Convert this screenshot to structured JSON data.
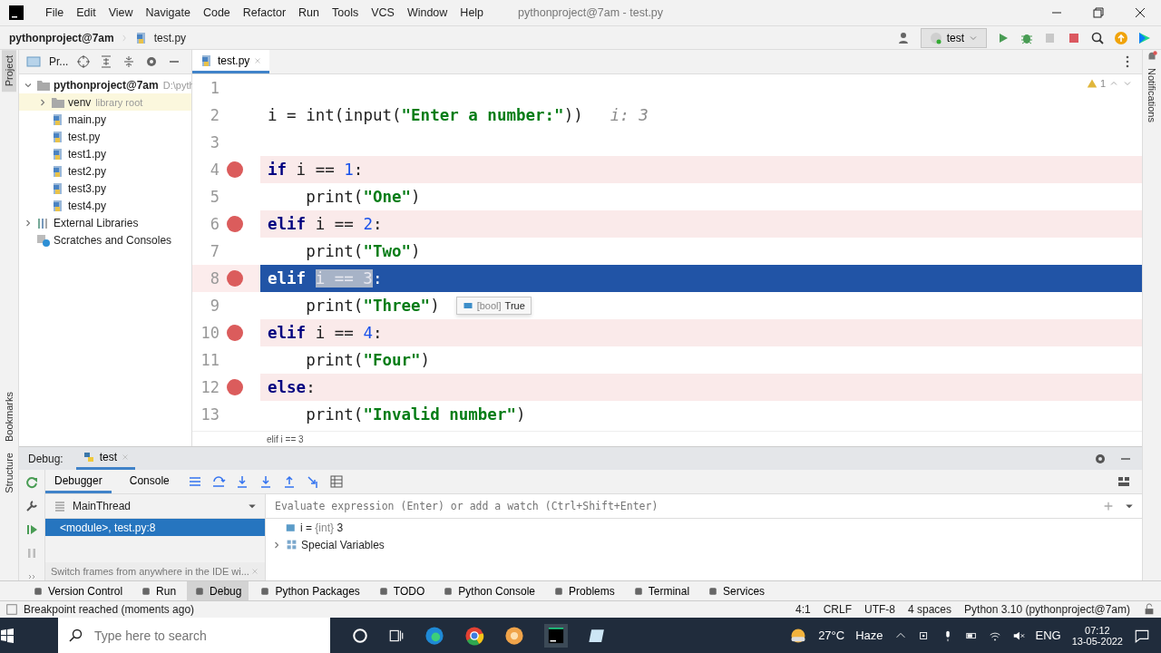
{
  "title_bar": {
    "menu": [
      "File",
      "Edit",
      "View",
      "Navigate",
      "Code",
      "Refactor",
      "Run",
      "Tools",
      "VCS",
      "Window",
      "Help"
    ],
    "title": "pythonproject@7am - test.py"
  },
  "nav_bar": {
    "breadcrumbs": [
      "pythonproject@7am",
      "test.py"
    ],
    "run_config": "test"
  },
  "side_strips": {
    "left_top": [
      {
        "label": "Project",
        "selected": true
      }
    ],
    "left_bottom": [
      {
        "label": "Bookmarks",
        "selected": false
      },
      {
        "label": "Structure",
        "selected": false
      }
    ],
    "right": [
      {
        "label": "Notifications",
        "selected": false
      }
    ]
  },
  "project_panel": {
    "title": "Pr...",
    "tree": [
      {
        "label": "pythonproject@7am",
        "hint": "D:\\pyth",
        "kind": "root",
        "expanded": true,
        "children": [
          {
            "label": "venv",
            "hint": "library root",
            "kind": "venv",
            "expanded": false
          },
          {
            "label": "main.py",
            "kind": "file"
          },
          {
            "label": "test.py",
            "kind": "file"
          },
          {
            "label": "test1.py",
            "kind": "file"
          },
          {
            "label": "test2.py",
            "kind": "file"
          },
          {
            "label": "test3.py",
            "kind": "file"
          },
          {
            "label": "test4.py",
            "kind": "file"
          }
        ]
      },
      {
        "label": "External Libraries",
        "kind": "library",
        "expanded": false
      },
      {
        "label": "Scratches and Consoles",
        "kind": "scratches"
      }
    ]
  },
  "editor": {
    "tabs": [
      {
        "label": "test.py",
        "selected": true
      }
    ],
    "inspection_count": "1",
    "breadcrumb": "elif i == 3",
    "lines": [
      {
        "number": "1",
        "breakpoint": false,
        "current": false
      },
      {
        "number": "2",
        "breakpoint": false,
        "current": false,
        "tokens": [
          {
            "kind": "plain",
            "text": "i = "
          },
          {
            "kind": "builtin",
            "text": "int"
          },
          {
            "kind": "plain",
            "text": "("
          },
          {
            "kind": "builtin",
            "text": "input"
          },
          {
            "kind": "plain",
            "text": "("
          },
          {
            "kind": "string",
            "text": "\"Enter a number:\""
          },
          {
            "kind": "plain",
            "text": "))"
          },
          {
            "kind": "hint",
            "text": "i: 3"
          }
        ]
      },
      {
        "number": "3",
        "breakpoint": false,
        "current": false
      },
      {
        "number": "4",
        "breakpoint": true,
        "current": false,
        "tokens": [
          {
            "kind": "keyword",
            "text": "if"
          },
          {
            "kind": "plain",
            "text": " i == "
          },
          {
            "kind": "number",
            "text": "1"
          },
          {
            "kind": "plain",
            "text": ":"
          }
        ]
      },
      {
        "number": "5",
        "breakpoint": false,
        "current": false,
        "indented": true,
        "tokens": [
          {
            "kind": "builtin",
            "text": "print"
          },
          {
            "kind": "plain",
            "text": "("
          },
          {
            "kind": "string",
            "text": "\"One\""
          },
          {
            "kind": "plain",
            "text": ")"
          }
        ]
      },
      {
        "number": "6",
        "breakpoint": true,
        "current": false,
        "tokens": [
          {
            "kind": "keyword",
            "text": "elif"
          },
          {
            "kind": "plain",
            "text": " i == "
          },
          {
            "kind": "number",
            "text": "2"
          },
          {
            "kind": "plain",
            "text": ":"
          }
        ]
      },
      {
        "number": "7",
        "breakpoint": false,
        "current": false,
        "indented": true,
        "tokens": [
          {
            "kind": "builtin",
            "text": "print"
          },
          {
            "kind": "plain",
            "text": "("
          },
          {
            "kind": "string",
            "text": "\"Two\""
          },
          {
            "kind": "plain",
            "text": ")"
          }
        ]
      },
      {
        "number": "8",
        "breakpoint": true,
        "current": true,
        "tokens": [
          {
            "kind": "keyword",
            "text": "elif "
          },
          {
            "kind": "selection",
            "text": "i == 3"
          },
          {
            "kind": "plain",
            "text": ":"
          }
        ]
      },
      {
        "number": "9",
        "breakpoint": false,
        "current": false,
        "indented": true,
        "tokens": [
          {
            "kind": "builtin",
            "text": "print"
          },
          {
            "kind": "plain",
            "text": "("
          },
          {
            "kind": "string",
            "text": "\"Three\""
          },
          {
            "kind": "plain",
            "text": ")"
          }
        ],
        "tooltip": {
          "type": "[bool]",
          "value": "True"
        }
      },
      {
        "number": "10",
        "breakpoint": true,
        "current": false,
        "tokens": [
          {
            "kind": "keyword",
            "text": "elif"
          },
          {
            "kind": "plain",
            "text": " i == "
          },
          {
            "kind": "number",
            "text": "4"
          },
          {
            "kind": "plain",
            "text": ":"
          }
        ]
      },
      {
        "number": "11",
        "breakpoint": false,
        "current": false,
        "indented": true,
        "tokens": [
          {
            "kind": "builtin",
            "text": "print"
          },
          {
            "kind": "plain",
            "text": "("
          },
          {
            "kind": "string",
            "text": "\"Four\""
          },
          {
            "kind": "plain",
            "text": ")"
          }
        ]
      },
      {
        "number": "12",
        "breakpoint": true,
        "current": false,
        "tokens": [
          {
            "kind": "keyword",
            "text": "else"
          },
          {
            "kind": "plain",
            "text": ":"
          }
        ]
      },
      {
        "number": "13",
        "breakpoint": false,
        "current": false,
        "indented": true,
        "tokens": [
          {
            "kind": "builtin",
            "text": "print"
          },
          {
            "kind": "plain",
            "text": "("
          },
          {
            "kind": "string",
            "text": "\"Invalid number\""
          },
          {
            "kind": "plain",
            "text": ")"
          }
        ]
      }
    ]
  },
  "debug": {
    "label": "Debug:",
    "session_tab": "test",
    "tabs": [
      {
        "label": "Debugger",
        "selected": true
      },
      {
        "label": "Console",
        "selected": false
      }
    ],
    "thread": "MainThread",
    "frames": [
      {
        "label": "<module>, test.py:8",
        "selected": true
      }
    ],
    "frames_hint": "Switch frames from anywhere in the IDE wi...",
    "watch_placeholder": "Evaluate expression (Enter) or add a watch (Ctrl+Shift+Enter)",
    "variables": [
      {
        "kind": "value",
        "name": "i = ",
        "type": "{int}",
        "value": "3"
      },
      {
        "kind": "group",
        "name": "Special Variables",
        "expanded": false
      }
    ]
  },
  "tool_windows": [
    {
      "label": "Version Control",
      "selected": false
    },
    {
      "label": "Run",
      "selected": false
    },
    {
      "label": "Debug",
      "selected": true
    },
    {
      "label": "Python Packages",
      "selected": false
    },
    {
      "label": "TODO",
      "selected": false
    },
    {
      "label": "Python Console",
      "selected": false
    },
    {
      "label": "Problems",
      "selected": false
    },
    {
      "label": "Terminal",
      "selected": false
    },
    {
      "label": "Services",
      "selected": false
    }
  ],
  "status_bar": {
    "message": "Breakpoint reached (moments ago)",
    "items": [
      "4:1",
      "CRLF",
      "UTF-8",
      "4 spaces",
      "Python 3.10 (pythonproject@7am)"
    ]
  },
  "taskbar": {
    "search_placeholder": "Type here to search",
    "temperature": "27°C",
    "weather": "Haze",
    "language": "ENG",
    "time": "07:12",
    "date": "13-05-2022"
  }
}
